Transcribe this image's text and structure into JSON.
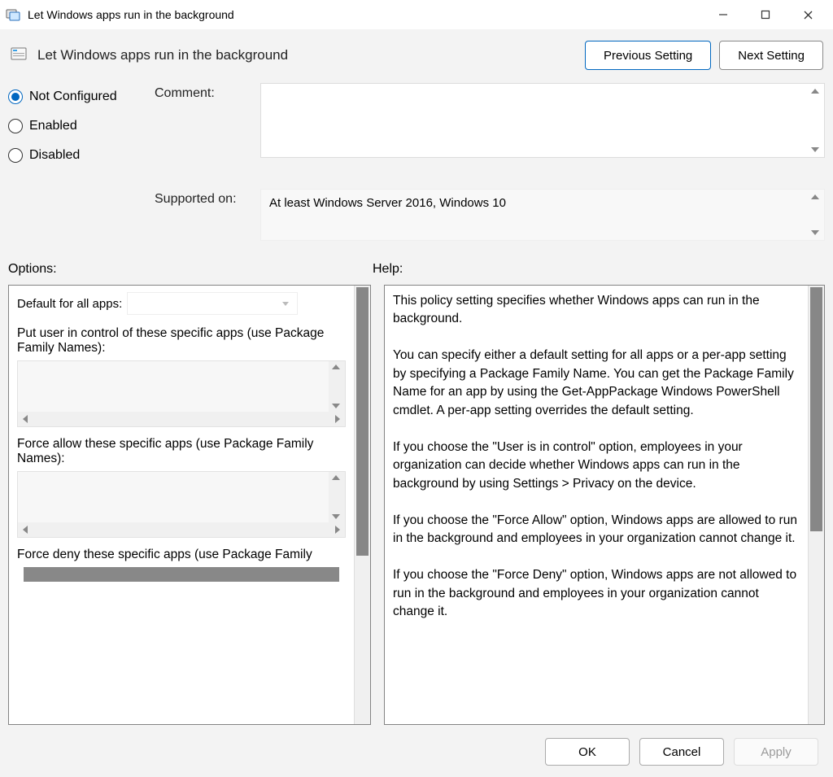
{
  "window": {
    "title": "Let Windows apps run in the background"
  },
  "header": {
    "policy_title": "Let Windows apps run in the background",
    "previous_label": "Previous Setting",
    "next_label": "Next Setting"
  },
  "state": {
    "radios": {
      "not_configured": "Not Configured",
      "enabled": "Enabled",
      "disabled": "Disabled",
      "selected": "not_configured"
    },
    "comment_label": "Comment:",
    "comment_value": "",
    "supported_label": "Supported on:",
    "supported_value": "At least Windows Server 2016, Windows 10"
  },
  "sections": {
    "options_label": "Options:",
    "help_label": "Help:"
  },
  "options": {
    "default_label": "Default for all apps:",
    "default_value": "",
    "group1_label": "Put user in control of these specific apps (use Package Family Names):",
    "group2_label": "Force allow these specific apps (use Package Family Names):",
    "group3_label": "Force deny these specific apps (use Package Family"
  },
  "help": {
    "text": "This policy setting specifies whether Windows apps can run in the background.\n\nYou can specify either a default setting for all apps or a per-app setting by specifying a Package Family Name. You can get the Package Family Name for an app by using the Get-AppPackage Windows PowerShell cmdlet. A per-app setting overrides the default setting.\n\nIf you choose the \"User is in control\" option, employees in your organization can decide whether Windows apps can run in the background by using Settings > Privacy on the device.\n\nIf you choose the \"Force Allow\" option, Windows apps are allowed to run in the background and employees in your organization cannot change it.\n\nIf you choose the \"Force Deny\" option, Windows apps are not allowed to run in the background and employees in your organization cannot change it."
  },
  "footer": {
    "ok": "OK",
    "cancel": "Cancel",
    "apply": "Apply"
  }
}
